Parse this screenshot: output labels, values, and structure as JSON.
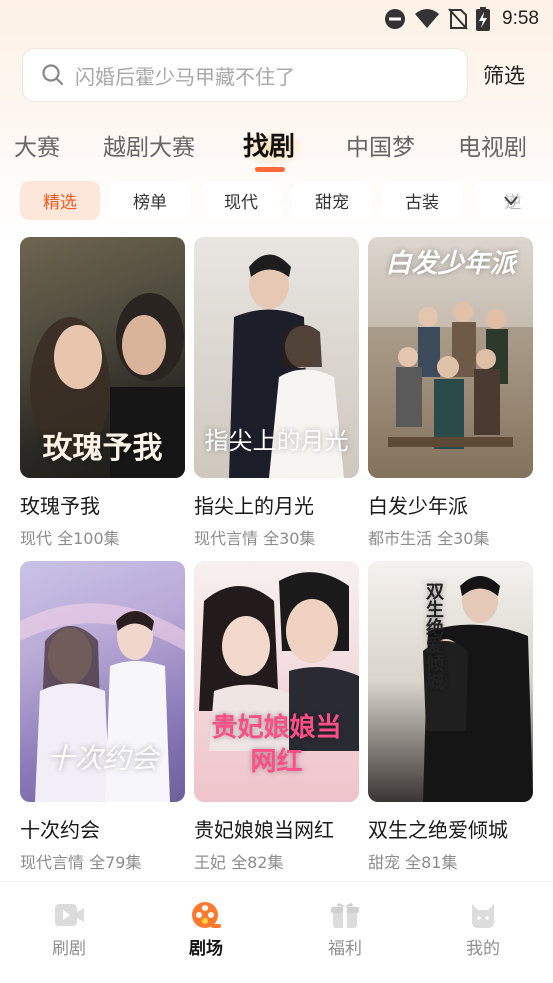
{
  "status_bar": {
    "time": "9:58"
  },
  "search": {
    "placeholder": "闪婚后霍少马甲藏不住了",
    "filter_label": "筛选"
  },
  "tabs": [
    "大赛",
    "越剧大赛",
    "找剧",
    "中国梦",
    "电视剧"
  ],
  "active_tab": "找剧",
  "chips": [
    "精选",
    "榜单",
    "现代",
    "甜宠",
    "古装",
    "逆"
  ],
  "active_chip": "精选",
  "dramas": [
    {
      "title": "玫瑰予我",
      "meta": "现代 全100集",
      "poster_text": "玫瑰予我"
    },
    {
      "title": "指尖上的月光",
      "meta": "现代言情 全30集",
      "poster_text": "指尖上的月光"
    },
    {
      "title": "白发少年派",
      "meta": "都市生活 全30集",
      "poster_text": "白发少年派"
    },
    {
      "title": "十次约会",
      "meta": "现代言情 全79集",
      "poster_text": "十次约会"
    },
    {
      "title": "贵妃娘娘当网红",
      "meta": "王妃 全82集",
      "poster_text": "贵妃娘娘当网红"
    },
    {
      "title": "双生之绝爱倾城",
      "meta": "甜宠 全81集",
      "poster_text": "双生绝爱倾城"
    }
  ],
  "bottom_nav": [
    "刷剧",
    "剧场",
    "福利",
    "我的"
  ],
  "active_nav": "剧场",
  "colors": {
    "accent": "#ff6a3d",
    "chip_active_bg": "#fde7db",
    "chip_active_text": "#f25b1e"
  }
}
